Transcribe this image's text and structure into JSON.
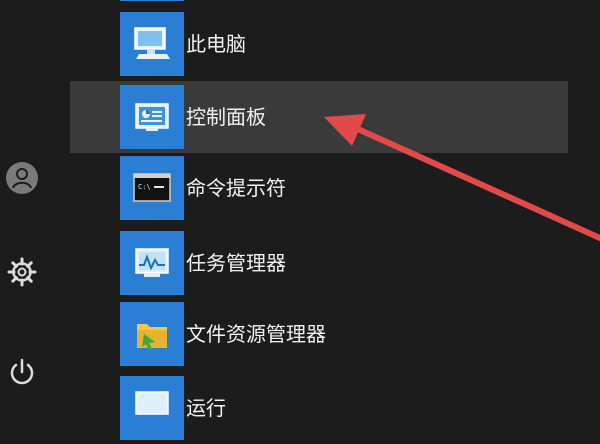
{
  "left_rail": {
    "icons": [
      "user-icon",
      "gear-icon",
      "power-icon"
    ]
  },
  "menu": {
    "items": [
      {
        "label": "",
        "icon": "top-partial-icon"
      },
      {
        "label": "此电脑",
        "icon": "computer-icon"
      },
      {
        "label": "控制面板",
        "icon": "control-panel-icon"
      },
      {
        "label": "命令提示符",
        "icon": "command-prompt-icon"
      },
      {
        "label": "任务管理器",
        "icon": "task-manager-icon"
      },
      {
        "label": "文件资源管理器",
        "icon": "file-explorer-icon"
      },
      {
        "label": "运行",
        "icon": "run-icon"
      }
    ]
  },
  "colors": {
    "background": "#1c1c1c",
    "tile_blue": "#2a7fd4",
    "highlight": "#3a3a3a",
    "annotation_arrow": "#e24a4a"
  }
}
